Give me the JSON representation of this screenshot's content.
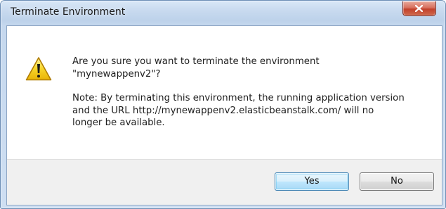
{
  "window": {
    "title": "Terminate Environment",
    "close_icon": "close-icon"
  },
  "message": {
    "question_line1": "Are you sure you want to terminate the environment",
    "question_line2": "\"mynewappenv2\"?",
    "note_line1": "Note: By terminating this environment, the running application version",
    "note_line2": "and the URL http://mynewappenv2.elasticbeanstalk.com/ will no",
    "note_line3": "longer be available.",
    "icon": "warning-icon"
  },
  "buttons": {
    "yes_label": "Yes",
    "no_label": "No",
    "default": "yes"
  },
  "colors": {
    "title_bar": "#c8daef",
    "close_button": "#c2412b",
    "footer": "#f0f0f0",
    "warning_fill": "#f5d21c"
  }
}
